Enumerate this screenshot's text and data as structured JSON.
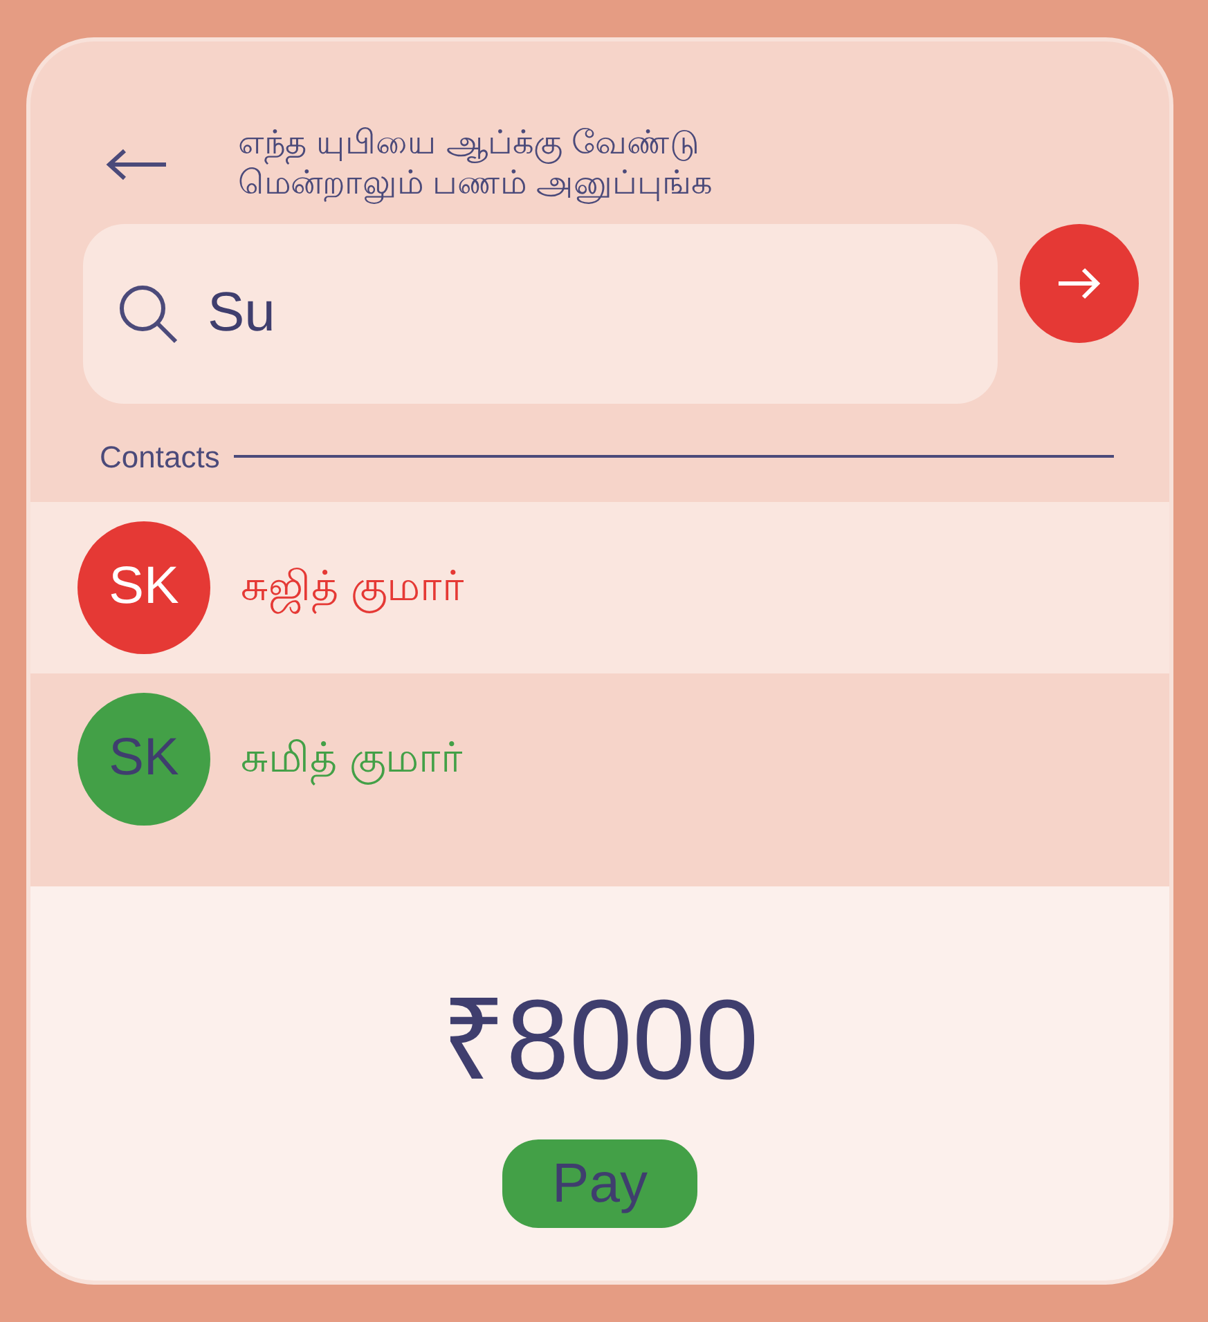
{
  "header": {
    "title_lines": [
      "எந்த யுபியை ஆப்க்கு வேண்டு",
      "மென்றாலும் பணம் அனுப்புங்க"
    ]
  },
  "search": {
    "value": "Su"
  },
  "contacts_label": "Contacts",
  "contacts": [
    {
      "initials": "SK",
      "name": "சுஜித் குமார்",
      "color": "#e53935",
      "selected": true
    },
    {
      "initials": "SK",
      "name": "சுமித் குமார்",
      "color": "#43a047",
      "selected": false
    }
  ],
  "amount": "₹8000",
  "pay_button": "Pay"
}
